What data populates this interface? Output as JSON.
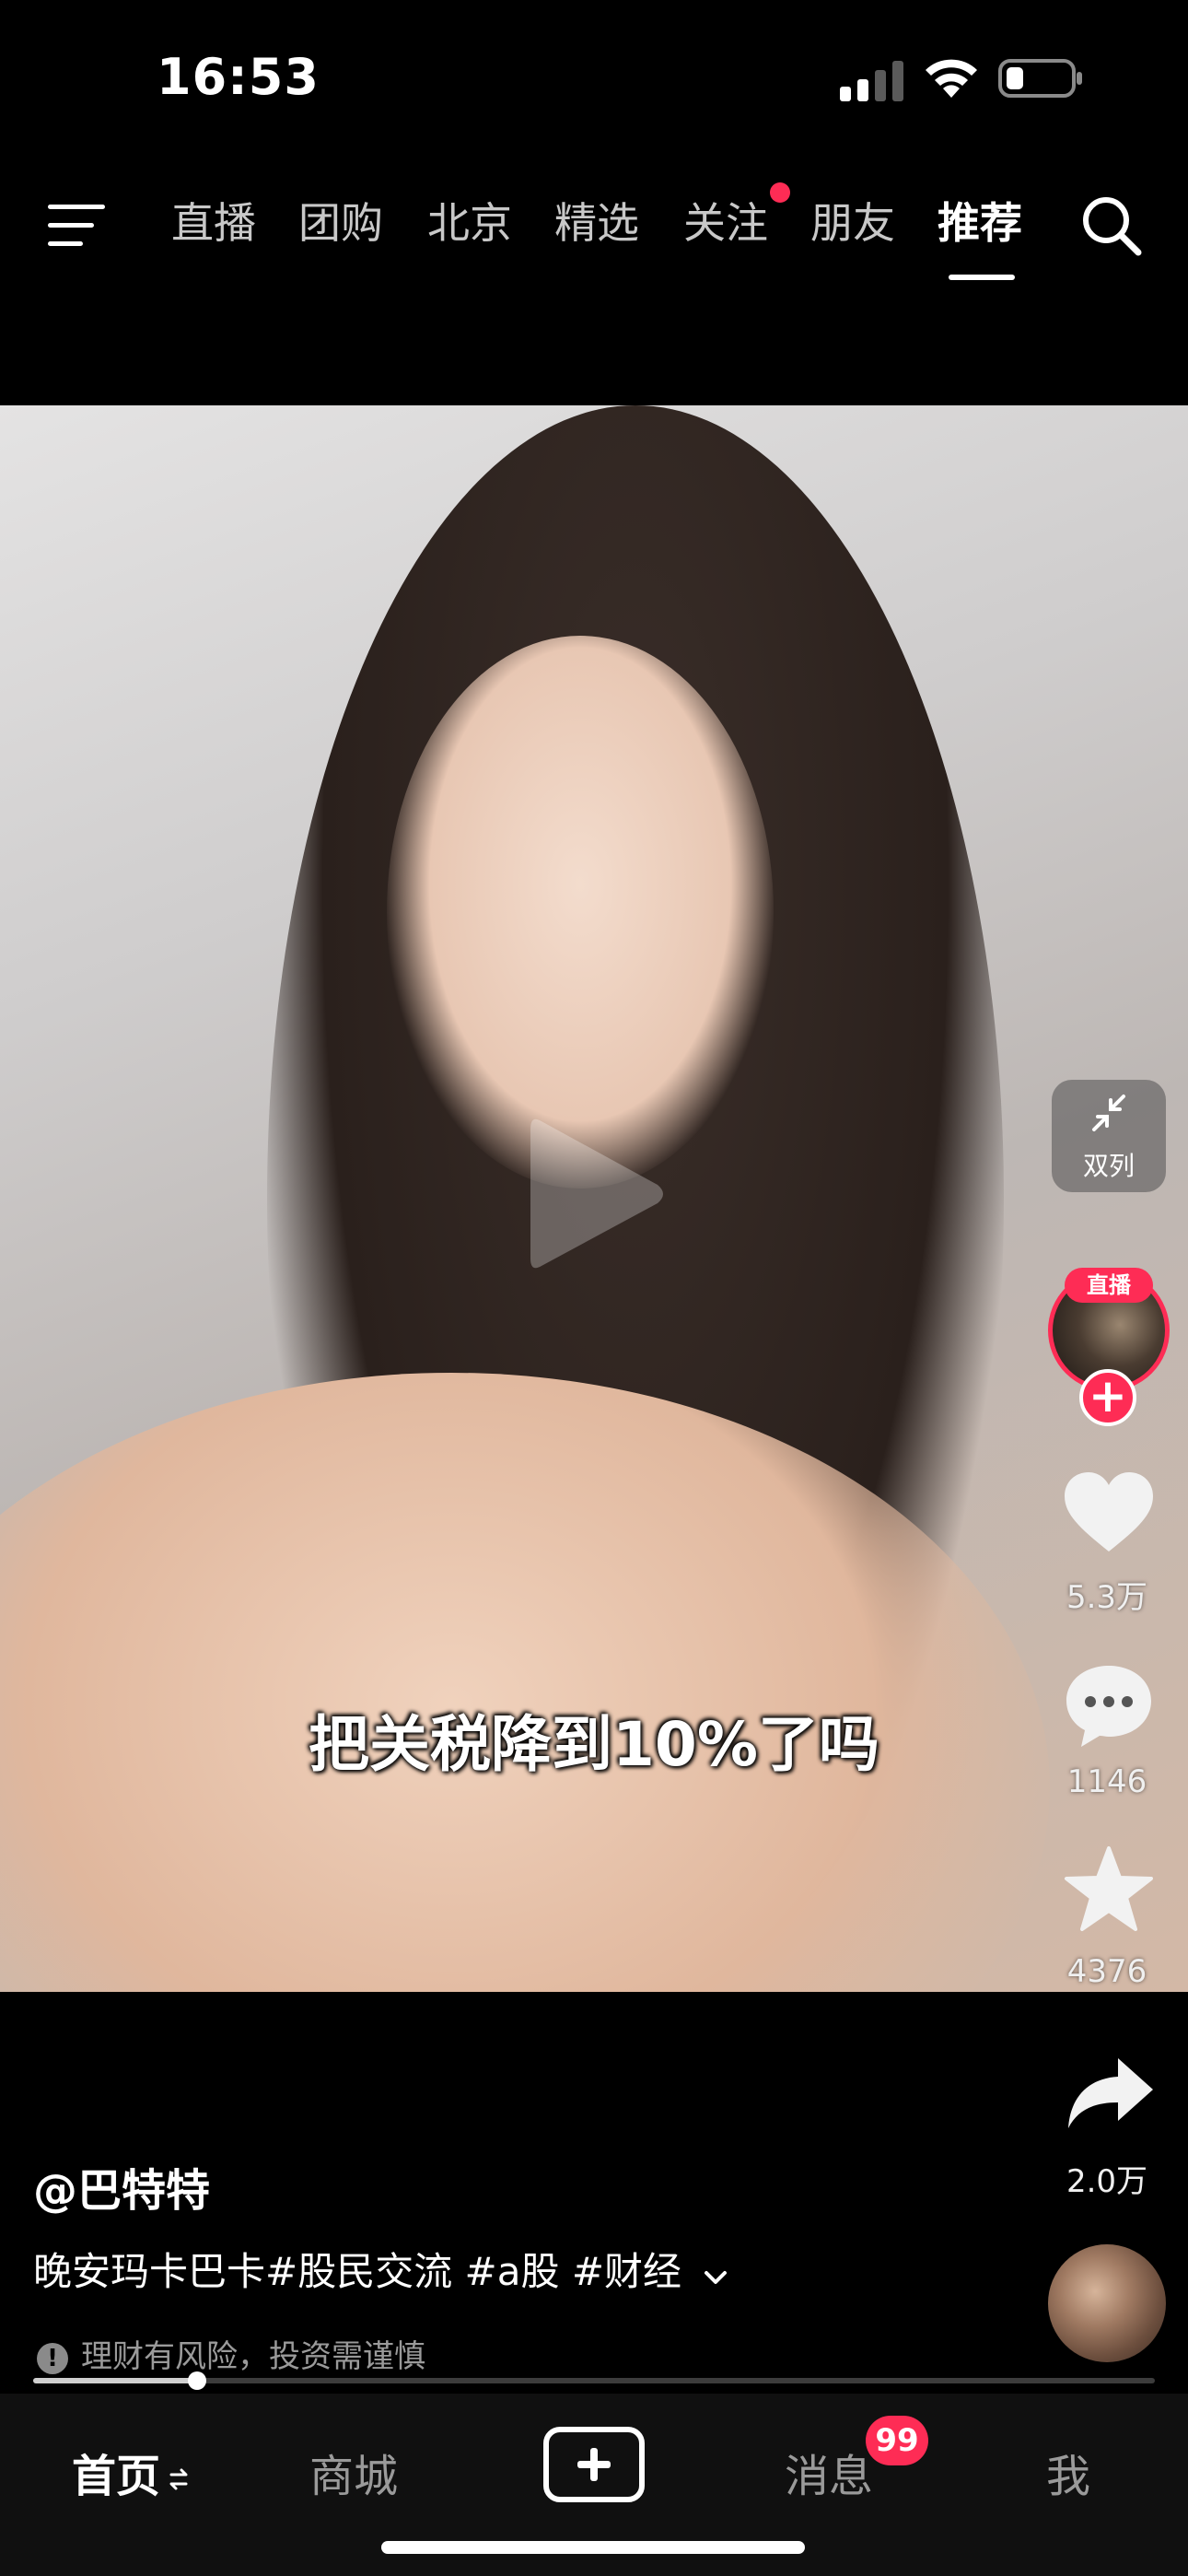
{
  "status_bar": {
    "time": "16:53"
  },
  "top_nav": {
    "tabs": [
      "直播",
      "团购",
      "北京",
      "精选",
      "关注",
      "朋友",
      "推荐"
    ],
    "active_tab": "推荐"
  },
  "video": {
    "caption": "把关税降到10%了吗"
  },
  "right_rail": {
    "dual_column_label": "双列",
    "live_badge": "直播",
    "likes": "5.3万",
    "comments": "1146",
    "favorites": "4376",
    "shares": "2.0万"
  },
  "post": {
    "author": "@巴特特",
    "description": "晚安玛卡巴卡#股民交流 #a股 #财经",
    "risk_notice": "理财有风险，投资需谨慎",
    "progress": 0.146
  },
  "bottom_tabs": {
    "home": "首页",
    "mall": "商城",
    "messages": "消息",
    "messages_badge": "99",
    "me": "我"
  },
  "colors": {
    "accent": "#fe2c55",
    "background": "#000000"
  }
}
